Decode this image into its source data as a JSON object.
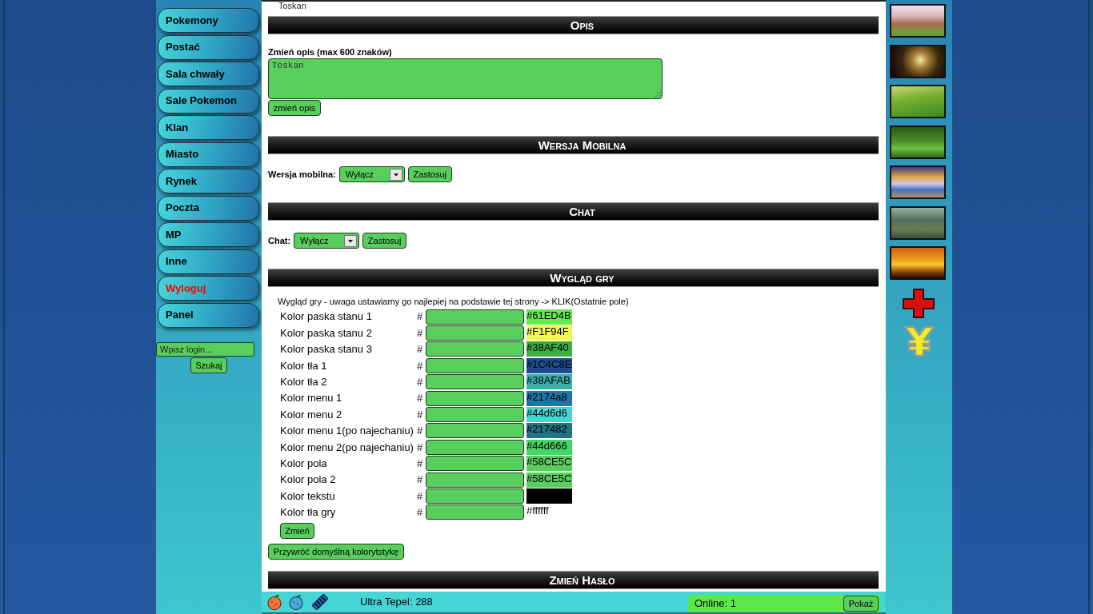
{
  "top_text": "Toskan",
  "sidebar": {
    "menu": [
      {
        "label": "Pokemony",
        "kind": "link"
      },
      {
        "label": "Postać",
        "kind": "link"
      },
      {
        "label": "Sala chwały",
        "kind": "link"
      },
      {
        "label": "Sale Pokemon",
        "kind": "link"
      },
      {
        "label": "Klan",
        "kind": "link"
      },
      {
        "label": "Miasto",
        "kind": "link"
      },
      {
        "label": "Rynek",
        "kind": "link"
      },
      {
        "label": "Poczta",
        "kind": "link"
      },
      {
        "label": "MP",
        "kind": "link"
      },
      {
        "label": "Inne",
        "kind": "link"
      },
      {
        "label": "Wyloguj",
        "kind": "logout"
      },
      {
        "label": "Panel",
        "kind": "link"
      }
    ],
    "search": {
      "placeholder": "Wpisz login...",
      "button": "Szukaj"
    }
  },
  "sections": [
    {
      "kind": "description",
      "title": "Opis",
      "label": "Zmień opis (max 600 znaków)",
      "value": "Toskan",
      "button": "zmień opis"
    },
    {
      "kind": "select",
      "title": "Wersja Mobilna",
      "label": "Wersja mobilna:",
      "value": "Wyłącz",
      "button": "Zastosuj"
    },
    {
      "kind": "select",
      "title": "Chat",
      "label": "Chat:",
      "value": "Wyłącz",
      "button": "Zastosuj"
    },
    {
      "kind": "colors",
      "title": "Wygląd gry",
      "intro": "Wygląd gry - uwaga ustawiamy go najlepiej na podstawie tej strony -> KLIK(Ostatnie pole)",
      "rows": [
        {
          "label": "Kolor paska stanu 1",
          "hash": "#",
          "color": "#61ed4b",
          "code": "#61ED4B"
        },
        {
          "label": "Kolor paska stanu 2",
          "hash": "#",
          "color": "#f1f94f",
          "code": "#F1F94F"
        },
        {
          "label": "Kolor paska stanu 3",
          "hash": "#",
          "color": "#38af40",
          "code": "#38AF40"
        },
        {
          "label": "Kolor tła 1",
          "hash": "#",
          "color": "#1c4c8e",
          "code": "#1C4C8E"
        },
        {
          "label": "Kolor tła 2",
          "hash": "#",
          "color": "#38afab",
          "code": "#38AFAB"
        },
        {
          "label": "Kolor menu 1",
          "hash": "#",
          "color": "#2174a8",
          "code": "#2174a8"
        },
        {
          "label": "Kolor menu 2",
          "hash": "#",
          "color": "#44d6d6",
          "code": "#44d6d6"
        },
        {
          "label": "Kolor menu 1(po najechaniu)",
          "hash": "#",
          "color": "#217482",
          "code": "#217482"
        },
        {
          "label": "Kolor menu 2(po najechaniu)",
          "hash": "#",
          "color": "#44d666",
          "code": "#44d666"
        },
        {
          "label": "Kolor pola",
          "hash": "#",
          "color": "#58ce5c",
          "code": "#58CE5C"
        },
        {
          "label": "Kolor pola 2",
          "hash": "#",
          "color": "#58ce5c",
          "code": "#58CE5C"
        },
        {
          "label": "Kolor tekstu",
          "hash": "#",
          "color": "#000000"
        },
        {
          "label": "Kolor tła gry",
          "hash": "#",
          "color": "#ffffff",
          "code": "#ffffff"
        }
      ],
      "submit": "Zmień",
      "reset": "Przywróć domyślną kolorytstykę"
    },
    {
      "kind": "header",
      "title": "Zmień Hasło"
    }
  ],
  "bottom_bar": {
    "currency": "Ultra Tepel: 288",
    "online": "Online: 1",
    "button": "Pokaż"
  }
}
